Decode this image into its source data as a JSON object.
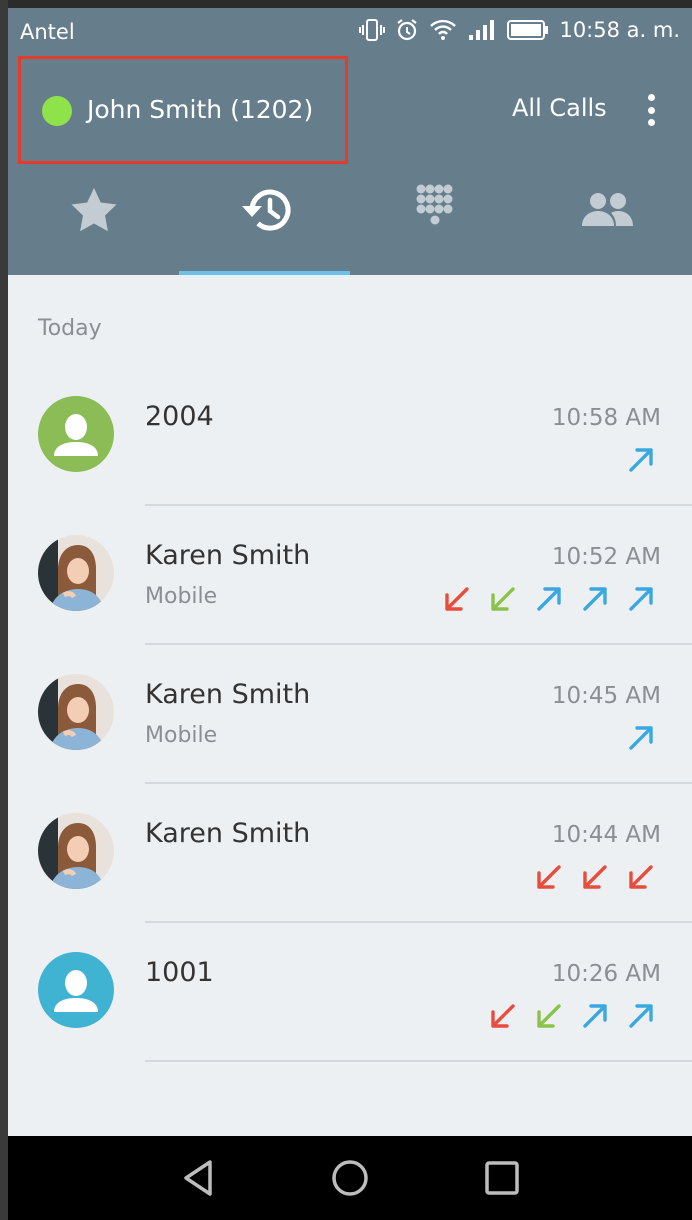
{
  "status_bar": {
    "carrier": "Antel",
    "time": "10:58 a. m.",
    "icons": [
      "vibrate-icon",
      "alarm-icon",
      "wifi-icon",
      "signal-icon",
      "battery-icon"
    ]
  },
  "header": {
    "account_name": "John Smith (1202)",
    "presence_color": "#8ee34a",
    "filter_label": "All Calls",
    "menu_icon": "overflow-menu-icon"
  },
  "tabs": [
    {
      "name": "favorites",
      "icon": "star-icon",
      "active": false
    },
    {
      "name": "history",
      "icon": "history-icon",
      "active": true
    },
    {
      "name": "dialpad",
      "icon": "dialpad-icon",
      "active": false
    },
    {
      "name": "contacts",
      "icon": "contacts-icon",
      "active": false
    }
  ],
  "section_label": "Today",
  "calls": [
    {
      "name": "2004",
      "subtitle": "",
      "time": "10:58 AM",
      "avatar": "placeholder",
      "avatar_color": "#8bbc55",
      "directions": [
        "outgoing"
      ]
    },
    {
      "name": "Karen Smith",
      "subtitle": "Mobile",
      "time": "10:52 AM",
      "avatar": "photo",
      "directions": [
        "missed",
        "incoming",
        "outgoing",
        "outgoing",
        "outgoing"
      ]
    },
    {
      "name": "Karen Smith",
      "subtitle": "Mobile",
      "time": "10:45 AM",
      "avatar": "photo",
      "directions": [
        "outgoing"
      ]
    },
    {
      "name": "Karen Smith",
      "subtitle": "",
      "time": "10:44 AM",
      "avatar": "photo",
      "directions": [
        "missed",
        "missed",
        "missed"
      ]
    },
    {
      "name": "1001",
      "subtitle": "",
      "time": "10:26 AM",
      "avatar": "placeholder",
      "avatar_color": "#40b3d3",
      "directions": [
        "missed",
        "incoming",
        "outgoing",
        "outgoing"
      ]
    }
  ],
  "direction_colors": {
    "outgoing": "#3aa8e0",
    "incoming": "#8bc34a",
    "missed": "#e74c3c"
  },
  "nav_bar": {
    "buttons": [
      "back-icon",
      "home-icon",
      "recents-icon"
    ]
  }
}
